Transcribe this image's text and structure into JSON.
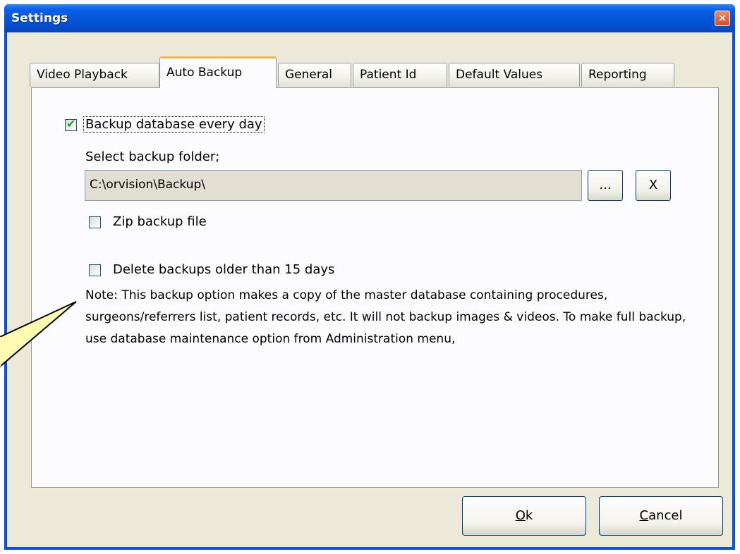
{
  "window": {
    "title": "Settings",
    "close_icon": "close-icon"
  },
  "tabs": [
    {
      "label": "Video Playback",
      "active": false
    },
    {
      "label": "Auto Backup",
      "active": true
    },
    {
      "label": "General",
      "active": false
    },
    {
      "label": "Patient Id",
      "active": false
    },
    {
      "label": "Default Values",
      "active": false
    },
    {
      "label": "Reporting",
      "active": false
    }
  ],
  "auto_backup": {
    "backup_daily": {
      "label": "Backup database every day",
      "checked": true
    },
    "folder_label": "Select backup folder;",
    "folder_path": "C:\\orvision\\Backup\\",
    "browse_label": "...",
    "clear_label": "X",
    "zip": {
      "label": "Zip backup file",
      "checked": false
    },
    "delete_old": {
      "label": "Delete backups older than 15 days",
      "checked": false
    },
    "note": "Note: This backup option makes a copy of the master database containing procedures, surgeons/referrers list, patient records, etc.  It will not backup images & videos. To make full backup, use database maintenance option from Administration menu,"
  },
  "buttons": {
    "ok_accel": "O",
    "ok_rest": "k",
    "cancel_accel": "C",
    "cancel_rest": "ancel"
  },
  "colors": {
    "titlebar": "#0553d6",
    "dialog_bg": "#ece9d8",
    "active_tab_accent": "#f6b641",
    "callout_fill": "#fffbb0"
  }
}
